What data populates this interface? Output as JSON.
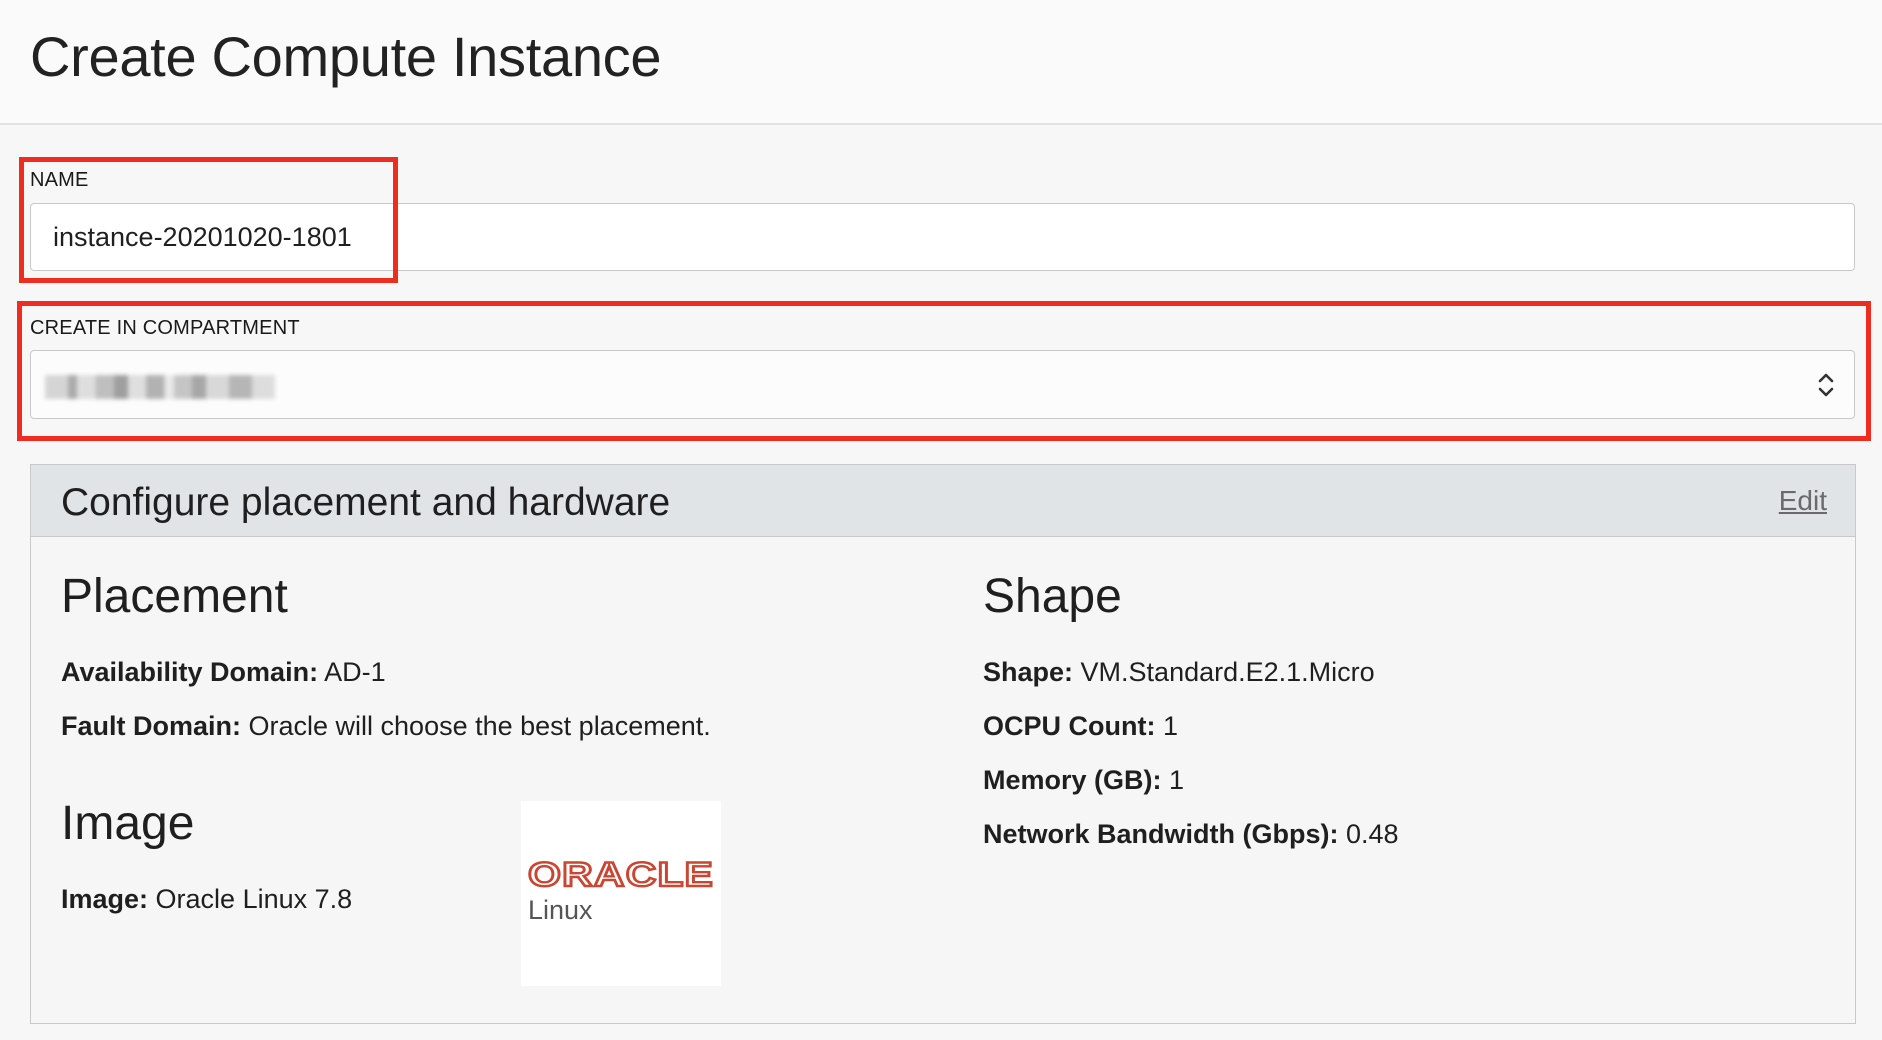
{
  "header": {
    "title": "Create Compute Instance"
  },
  "form": {
    "name": {
      "label": "NAME",
      "value": "instance-20201020-1801"
    },
    "compartment": {
      "label": "CREATE IN COMPARTMENT"
    }
  },
  "panel": {
    "title": "Configure placement and hardware",
    "edit_label": "Edit",
    "placement": {
      "title": "Placement",
      "availability_domain_label": "Availability Domain:",
      "availability_domain_value": "AD-1",
      "fault_domain_label": "Fault Domain:",
      "fault_domain_value": "Oracle will choose the best placement."
    },
    "image": {
      "title": "Image",
      "image_label": "Image:",
      "image_value": "Oracle Linux 7.8",
      "logo_word": "ORACLE",
      "logo_sub": "Linux"
    },
    "shape": {
      "title": "Shape",
      "shape_label": "Shape:",
      "shape_value": "VM.Standard.E2.1.Micro",
      "ocpu_label": "OCPU Count:",
      "ocpu_value": "1",
      "memory_label": "Memory (GB):",
      "memory_value": "1",
      "bandwidth_label": "Network Bandwidth (Gbps):",
      "bandwidth_value": "0.48"
    }
  },
  "colors": {
    "highlight": "#ee2d20",
    "oracle_red": "#c74634",
    "panel_header": "#e1e4e7"
  },
  "icons": {
    "select_arrows": "chevron-up-down-icon"
  }
}
